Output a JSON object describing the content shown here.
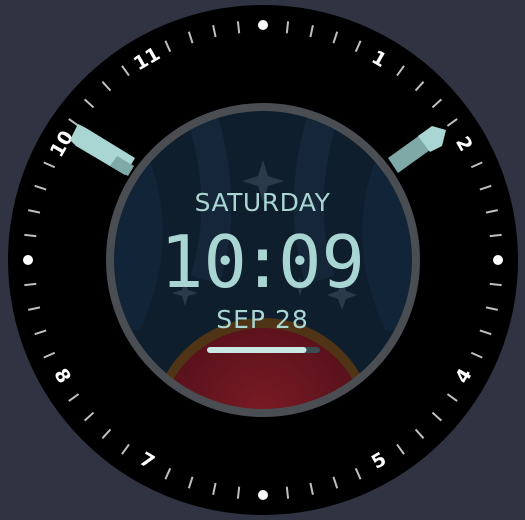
{
  "watch_face": {
    "day_label": "SATURDAY",
    "time": {
      "hours": "10",
      "separator": ":",
      "minutes": "09"
    },
    "date_label": "SEP 28",
    "progress_fraction": 0.88,
    "hour_numerals": [
      "1",
      "2",
      "4",
      "5",
      "7",
      "8",
      "10",
      "11"
    ],
    "icons": [
      "sparkle-star-icon",
      "planet-icon"
    ]
  },
  "colors": {
    "background": "#2f3342",
    "bezel": "#000000",
    "accent": "#a9d6d3",
    "inner_ring": "#4a4d52",
    "dial_bg": "#0f1e2c",
    "planet": "#6e1520"
  }
}
